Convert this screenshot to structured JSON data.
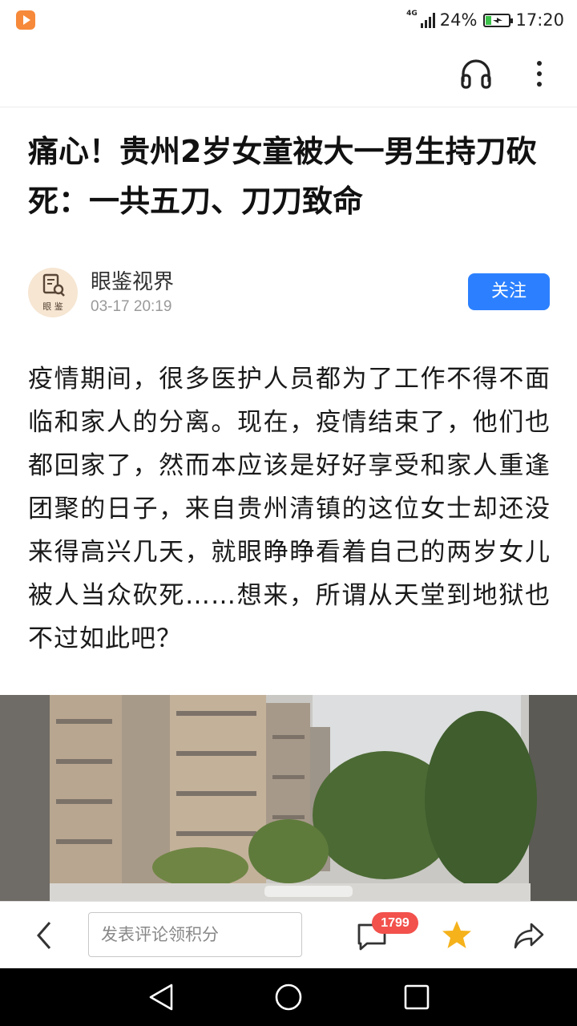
{
  "status_bar": {
    "network": "4G",
    "battery_percent": "24%",
    "battery_level": 0.24,
    "time": "17:20",
    "icons": [
      "app-badge-icon",
      "signal-icon",
      "battery-charging-icon"
    ]
  },
  "toolbar": {
    "icons": [
      "headphones-icon",
      "more-vertical-icon"
    ]
  },
  "article": {
    "title": "痛心！贵州2岁女童被大一男生持刀砍死：一共五刀、刀刀致命",
    "author": {
      "name": "眼鉴视界",
      "date": "03-17 20:19",
      "avatar_text": "眼 鉴",
      "follow_label": "关注"
    },
    "body": "疫情期间，很多医护人员都为了工作不得不面临和家人的分离。现在，疫情结束了，他们也都回家了，然而本应该是好好享受和家人重逢团聚的日子，来自贵州清镇的这位女士却还没来得高兴几天，就眼睁睁看着自己的两岁女儿被人当众砍死……想来，所谓从天堂到地狱也不过如此吧？"
  },
  "bottom_bar": {
    "comment_placeholder": "发表评论领积分",
    "comment_count": "1799",
    "icons": [
      "back-chevron-icon",
      "comment-icon",
      "star-icon",
      "share-icon"
    ],
    "star_color": "#f5b21b"
  },
  "nav_bar": {
    "icons": [
      "nav-back-icon",
      "nav-home-icon",
      "nav-recents-icon"
    ]
  },
  "colors": {
    "accent": "#2c80ff",
    "badge": "#f2514c",
    "app_badge": "#f6893a"
  }
}
